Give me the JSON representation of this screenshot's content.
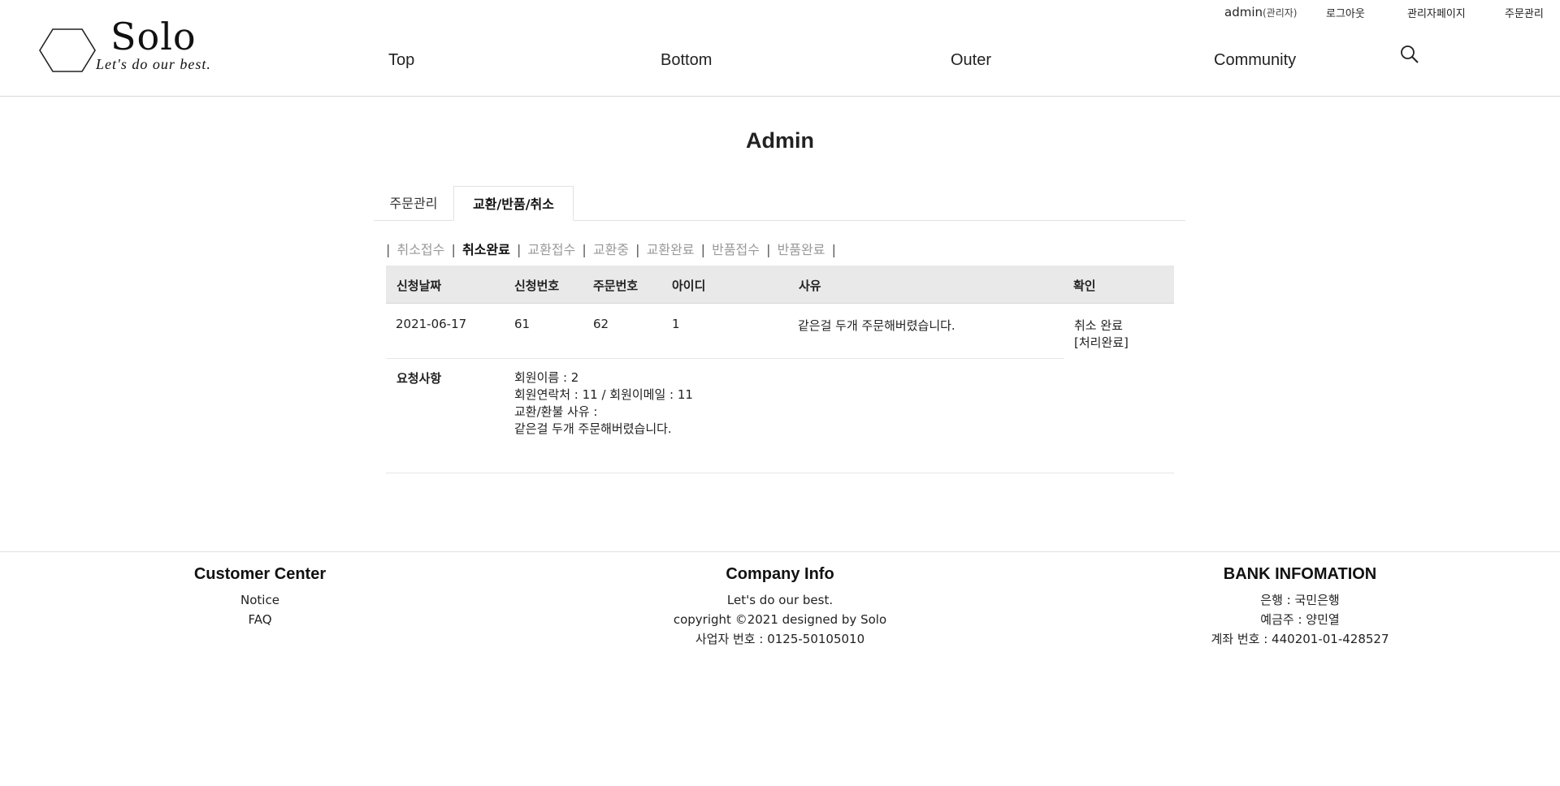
{
  "brand": {
    "title": "Solo",
    "tagline": "Let's do our best."
  },
  "util_nav": {
    "user": "admin",
    "user_role": "(관리자)",
    "logout": "로그아웃",
    "admin_page": "관리자페이지",
    "order_manage": "주문관리"
  },
  "gnb": [
    "Top",
    "Bottom",
    "Outer",
    "Community"
  ],
  "page_title": "Admin",
  "tabs": [
    {
      "label": "주문관리",
      "active": false
    },
    {
      "label": "교환/반품/취소",
      "active": true
    }
  ],
  "sub_tabs": [
    {
      "label": "취소접수",
      "active": false
    },
    {
      "label": "취소완료",
      "active": true
    },
    {
      "label": "교환접수",
      "active": false
    },
    {
      "label": "교환중",
      "active": false
    },
    {
      "label": "교환완료",
      "active": false
    },
    {
      "label": "반품접수",
      "active": false
    },
    {
      "label": "반품완료",
      "active": false
    }
  ],
  "table": {
    "headers": [
      "신청날짜",
      "신청번호",
      "주문번호",
      "아이디",
      "사유",
      "확인"
    ],
    "rows": [
      {
        "date": "2021-06-17",
        "request_no": "61",
        "order_no": "62",
        "user_id": "1",
        "reason": "같은걸 두개 주문해버렸습니다.",
        "status": "취소 완료",
        "status_note": "[처리완료]",
        "request_label": "요청사항",
        "request_lines": [
          "회원이름 : 2",
          "회원연락처 : 11 / 회원이메일 : 11",
          "교환/환불 사유 :",
          "같은걸 두개 주문해버렸습니다."
        ]
      }
    ]
  },
  "footer": {
    "customer_center": {
      "title": "Customer Center",
      "links": [
        "Notice",
        "FAQ"
      ]
    },
    "company_info": {
      "title": "Company Info",
      "lines": [
        "Let's do our best.",
        "copyright ©2021 designed by Solo",
        "사업자 번호 : 0125-50105010"
      ]
    },
    "bank_info": {
      "title": "BANK INFOMATION",
      "lines": [
        "은행 : 국민은행",
        "예금주 : 양민열",
        "계좌 번호 : 440201-01-428527"
      ]
    }
  }
}
